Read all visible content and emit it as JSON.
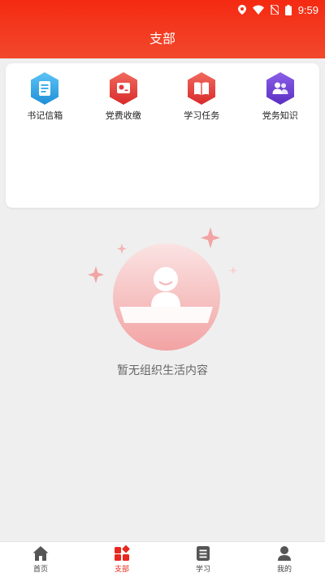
{
  "status_bar": {
    "time": "9:59"
  },
  "header": {
    "title": "支部"
  },
  "grid": {
    "items": [
      {
        "label": "书记信箱",
        "icon": "mailbox-icon",
        "color": "#2ea6e8"
      },
      {
        "label": "党费收缴",
        "icon": "party-fee-icon",
        "color": "#e5393a"
      },
      {
        "label": "学习任务",
        "icon": "book-icon",
        "color": "#e5393a"
      },
      {
        "label": "党务知识",
        "icon": "people-icon",
        "color": "#6a3fd1"
      }
    ]
  },
  "empty_state": {
    "message": "暂无组织生活内容"
  },
  "tabbar": {
    "tabs": [
      {
        "label": "首页",
        "icon": "home-icon",
        "active": false
      },
      {
        "label": "支部",
        "icon": "branch-icon",
        "active": true
      },
      {
        "label": "学习",
        "icon": "study-icon",
        "active": false
      },
      {
        "label": "我的",
        "icon": "profile-icon",
        "active": false
      }
    ]
  },
  "colors": {
    "primary": "#f42a12",
    "active_tab": "#e8281e"
  }
}
